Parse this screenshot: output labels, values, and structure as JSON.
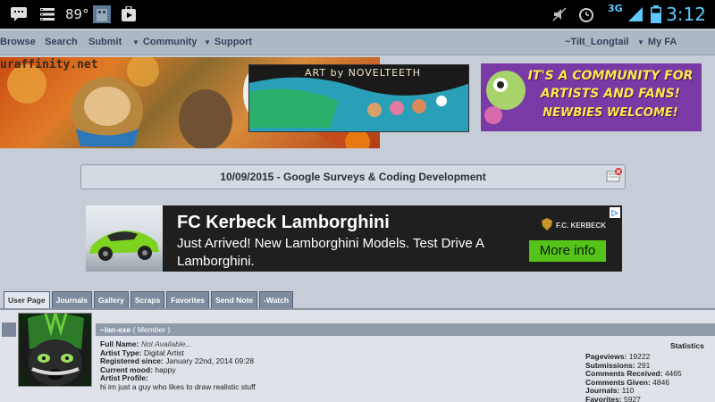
{
  "status_bar": {
    "temperature": "89°",
    "time": "3:12",
    "network": "3G"
  },
  "nav": {
    "browse": "Browse",
    "search": "Search",
    "submit": "Submit",
    "community": "Community",
    "support": "Support",
    "username": "~Tilt_Longtail",
    "my_fa": "My FA"
  },
  "banners": {
    "site_banner_text": "uraffinity.net",
    "art_credit": "ART by NOVELTEETH",
    "ad_line1": "IT'S A COMMUNITY FOR",
    "ad_line2": "ARTISTS AND FANS!",
    "ad_line3": "NEWBIES WELCOME!"
  },
  "notice": {
    "text": "10/09/2015 - Google Surveys & Coding Development"
  },
  "ad": {
    "title": "FC Kerbeck Lamborghini",
    "body": "Just Arrived! New Lamborghini Models. Test Drive A Lamborghini.",
    "brand": "F.C. KERBECK",
    "cta": "More info"
  },
  "tabs": [
    "User Page",
    "Journals",
    "Gallery",
    "Scraps",
    "Favorites",
    "Send Note",
    "-Watch"
  ],
  "profile": {
    "username": "~lan-exe",
    "role": "( Member )",
    "full_name_label": "Full Name:",
    "full_name": "Not Available...",
    "artist_type_label": "Artist Type:",
    "artist_type": "Digital Artist",
    "registered_label": "Registered since:",
    "registered": "January 22nd, 2014 09:28",
    "mood_label": "Current mood:",
    "mood": "happy",
    "artist_profile_label": "Artist Profile:",
    "bio": "hi im just a guy who likes to draw realistic stuff"
  },
  "statistics": {
    "title": "Statistics",
    "pageviews_label": "Pageviews:",
    "pageviews": "19222",
    "submissions_label": "Submissions:",
    "submissions": "291",
    "comments_received_label": "Comments Received:",
    "comments_received": "4465",
    "comments_given_label": "Comments Given:",
    "comments_given": "4846",
    "journals_label": "Journals:",
    "journals": "110",
    "favorites_label": "Favorites:",
    "favorites": "5927"
  }
}
